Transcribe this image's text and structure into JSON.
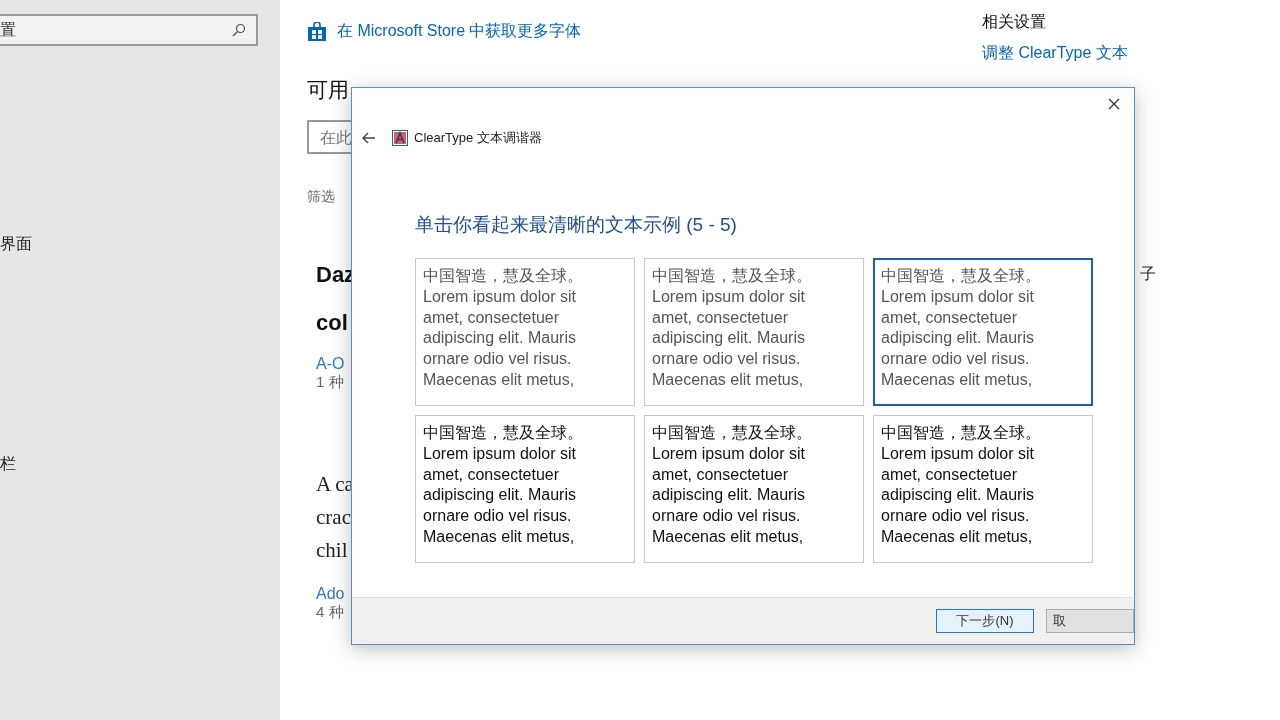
{
  "sidebar": {
    "search": {
      "value": "置"
    },
    "items": [
      {
        "label": "界面"
      },
      {
        "label": "栏"
      }
    ]
  },
  "main": {
    "store_link": "在 Microsoft Store 中获取更多字体",
    "fragments": [
      {
        "kind": "heading",
        "text": "可用"
      },
      {
        "kind": "field",
        "text": "在此"
      },
      {
        "kind": "label",
        "text": "筛选"
      },
      {
        "kind": "font-name",
        "text": "Daz"
      },
      {
        "kind": "font-name",
        "text": "col"
      },
      {
        "kind": "link",
        "text": "A-O"
      },
      {
        "kind": "meta",
        "text": "1 种"
      },
      {
        "kind": "serif",
        "text": "A ca"
      },
      {
        "kind": "serif",
        "text": "crac"
      },
      {
        "kind": "serif",
        "text": "chil"
      },
      {
        "kind": "link",
        "text": "Ado"
      },
      {
        "kind": "meta",
        "text": "4 种"
      }
    ],
    "side_fragment": "子"
  },
  "related": {
    "title": "相关设置",
    "link": "调整 ClearType 文本"
  },
  "dialog": {
    "title": "ClearType 文本调谐器",
    "heading": "单击你看起来最清晰的文本示例 (5 - 5)",
    "samples": [
      {
        "selected": false,
        "kind": "light",
        "lines": [
          "中国智造，慧及全球。",
          "Lorem ipsum dolor sit",
          "amet, consectetuer",
          "adipiscing elit. Mauris",
          "ornare odio vel risus.",
          "Maecenas elit metus,"
        ]
      },
      {
        "selected": false,
        "kind": "light",
        "lines": [
          "中国智造，慧及全球。",
          "Lorem ipsum dolor sit",
          "amet, consectetuer",
          "adipiscing elit. Mauris",
          "ornare odio vel risus.",
          "Maecenas elit metus,"
        ]
      },
      {
        "selected": true,
        "kind": "light",
        "lines": [
          "中国智造，慧及全球。",
          "Lorem ipsum dolor sit",
          "amet, consectetuer",
          "adipiscing elit. Mauris",
          "ornare odio vel risus.",
          "Maecenas elit metus,"
        ]
      },
      {
        "selected": false,
        "kind": "dark",
        "lines": [
          "中国智造，慧及全球。",
          "Lorem ipsum dolor sit",
          "amet, consectetuer",
          "adipiscing elit. Mauris",
          "ornare odio vel risus.",
          "Maecenas elit metus,"
        ]
      },
      {
        "selected": false,
        "kind": "dark",
        "lines": [
          "中国智造，慧及全球。",
          "Lorem ipsum dolor sit",
          "amet, consectetuer",
          "adipiscing elit. Mauris",
          "ornare odio vel risus.",
          "Maecenas elit metus,"
        ]
      },
      {
        "selected": false,
        "kind": "dark",
        "lines": [
          "中国智造，慧及全球。",
          "Lorem ipsum dolor sit",
          "amet, consectetuer",
          "adipiscing elit. Mauris",
          "ornare odio vel risus.",
          "Maecenas elit metus,"
        ]
      }
    ],
    "buttons": [
      {
        "label": "下一步(N)",
        "focused": true
      },
      {
        "label": "取",
        "focused": false
      }
    ]
  }
}
